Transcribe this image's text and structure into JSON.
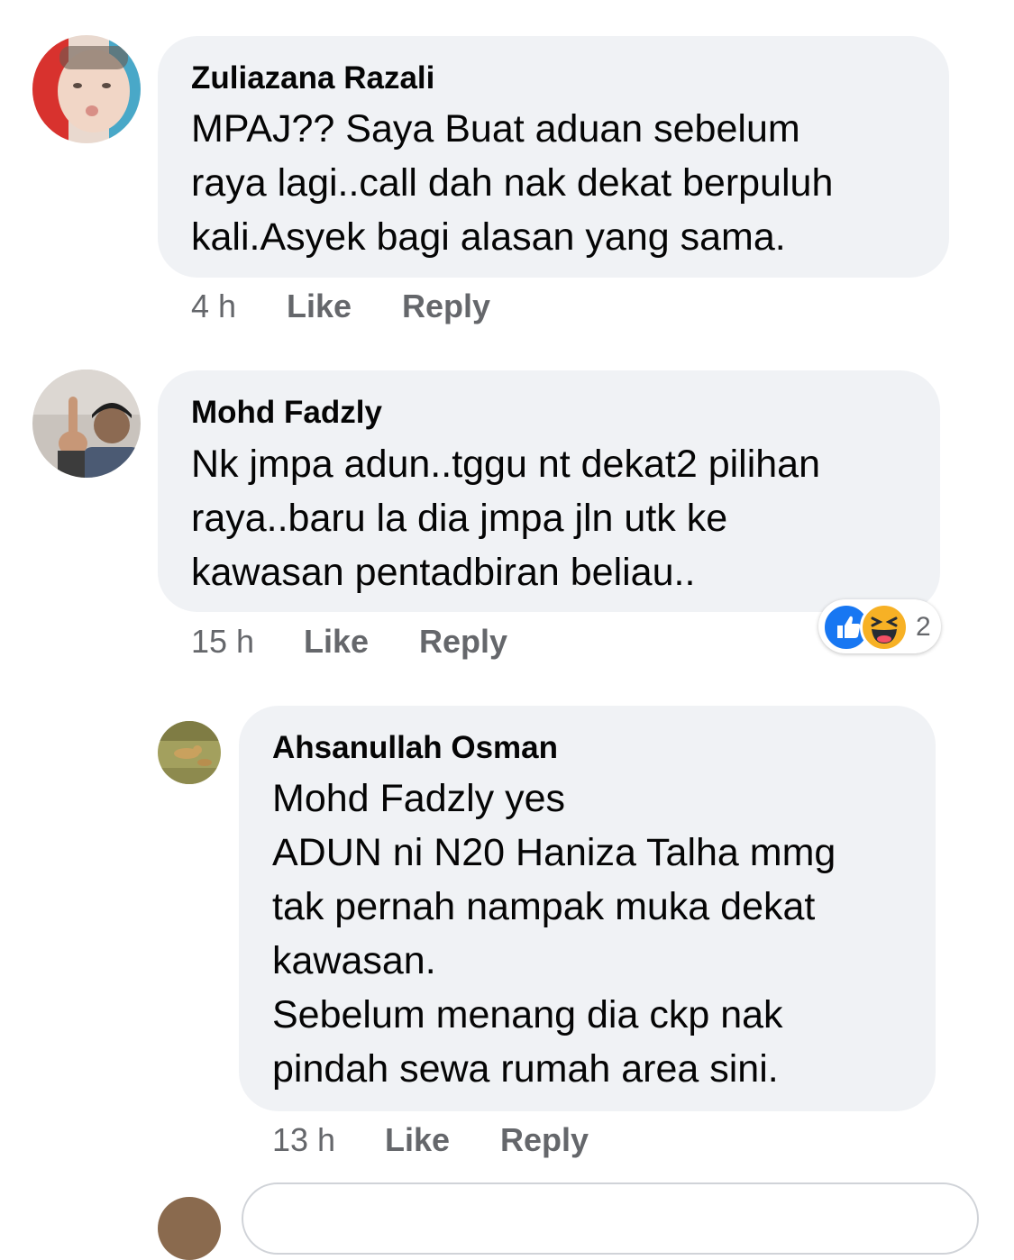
{
  "comments": [
    {
      "author": "Zuliazana Razali",
      "lines": [
        "MPAJ?? Saya Buat aduan sebelum",
        "raya lagi..call dah nak dekat berpuluh",
        "kali.Asyek bagi alasan yang sama."
      ],
      "time": "4 h",
      "like_label": "Like",
      "reply_label": "Reply"
    },
    {
      "author": "Mohd Fadzly",
      "lines": [
        "Nk jmpa adun..tggu nt dekat2 pilihan",
        "raya..baru la dia jmpa jln utk ke",
        "kawasan pentadbiran beliau.."
      ],
      "time": "15 h",
      "like_label": "Like",
      "reply_label": "Reply",
      "reactions": {
        "icons": [
          "like-icon",
          "haha-icon"
        ],
        "count": "2",
        "colors": {
          "like": "#1877f2",
          "haha": "#f7b125"
        }
      }
    },
    {
      "author": "Ahsanullah Osman",
      "lines": [
        "Mohd Fadzly yes",
        "ADUN ni N20 Haniza Talha mmg",
        "tak pernah nampak muka dekat",
        "kawasan.",
        "Sebelum menang dia ckp nak",
        "pindah sewa rumah area sini."
      ],
      "time": "13 h",
      "like_label": "Like",
      "reply_label": "Reply"
    }
  ],
  "colors": {
    "bubble": "#f0f2f5",
    "text": "#050505",
    "secondary": "#65676b"
  }
}
